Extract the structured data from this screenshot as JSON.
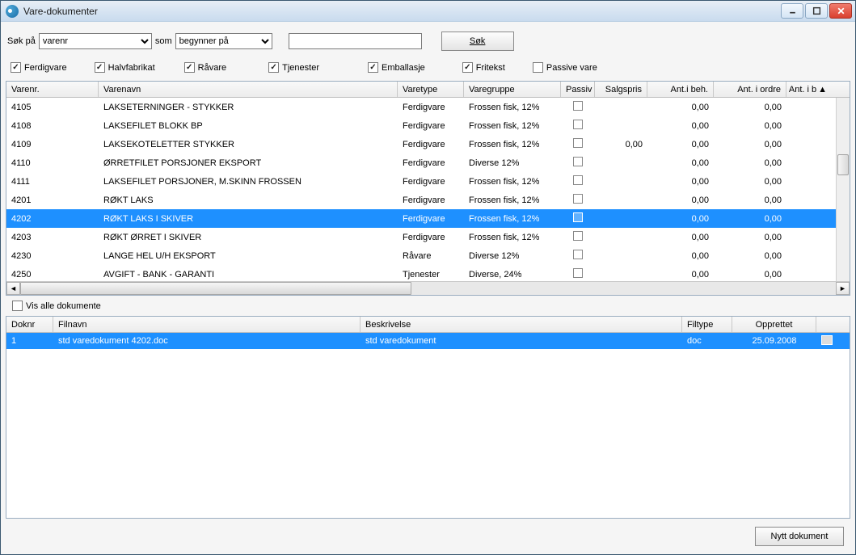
{
  "window": {
    "title": "Vare-dokumenter"
  },
  "search": {
    "label_sokpa": "Søk på",
    "field_options": [
      "varenr"
    ],
    "field_value": "varenr",
    "label_som": "som",
    "mode_options": [
      "begynner på"
    ],
    "mode_value": "begynner på",
    "input_value": "",
    "button": "Søk"
  },
  "filters": [
    {
      "label": "Ferdigvare",
      "checked": true
    },
    {
      "label": "Halvfabrikat",
      "checked": true
    },
    {
      "label": "Råvare",
      "checked": true
    },
    {
      "label": "Tjenester",
      "checked": true
    },
    {
      "label": "Emballasje",
      "checked": true
    },
    {
      "label": "Fritekst",
      "checked": true
    },
    {
      "label": "Passive vare",
      "checked": false
    }
  ],
  "products": {
    "columns": [
      "Varenr.",
      "Varenavn",
      "Varetype",
      "Varegruppe",
      "Passiv",
      "Salgspris",
      "Ant.i beh.",
      "Ant. i ordre",
      "Ant. i b"
    ],
    "rows": [
      {
        "nr": "4105",
        "navn": "LAKSETERNINGER - STYKKER",
        "type": "Ferdigvare",
        "gruppe": "Frossen fisk, 12%",
        "passiv": false,
        "salg": "",
        "beh": "0,00",
        "ordre": "0,00",
        "selected": false
      },
      {
        "nr": "4108",
        "navn": "LAKSEFILET BLOKK BP",
        "type": "Ferdigvare",
        "gruppe": "Frossen fisk, 12%",
        "passiv": false,
        "salg": "",
        "beh": "0,00",
        "ordre": "0,00",
        "selected": false
      },
      {
        "nr": "4109",
        "navn": "LAKSEKOTELETTER STYKKER",
        "type": "Ferdigvare",
        "gruppe": "Frossen fisk, 12%",
        "passiv": false,
        "salg": "0,00",
        "beh": "0,00",
        "ordre": "0,00",
        "selected": false
      },
      {
        "nr": "4110",
        "navn": "ØRRETFILET PORSJONER EKSPORT",
        "type": "Ferdigvare",
        "gruppe": "Diverse 12%",
        "passiv": false,
        "salg": "",
        "beh": "0,00",
        "ordre": "0,00",
        "selected": false
      },
      {
        "nr": "4111",
        "navn": "LAKSEFILET PORSJONER, M.SKINN FROSSEN",
        "type": "Ferdigvare",
        "gruppe": "Frossen fisk, 12%",
        "passiv": false,
        "salg": "",
        "beh": "0,00",
        "ordre": "0,00",
        "selected": false
      },
      {
        "nr": "4201",
        "navn": "RØKT LAKS",
        "type": "Ferdigvare",
        "gruppe": "Frossen fisk, 12%",
        "passiv": false,
        "salg": "",
        "beh": "0,00",
        "ordre": "0,00",
        "selected": false
      },
      {
        "nr": "4202",
        "navn": "RØKT LAKS I SKIVER",
        "type": "Ferdigvare",
        "gruppe": "Frossen fisk, 12%",
        "passiv": false,
        "salg": "",
        "beh": "0,00",
        "ordre": "0,00",
        "selected": true
      },
      {
        "nr": "4203",
        "navn": "RØKT ØRRET I SKIVER",
        "type": "Ferdigvare",
        "gruppe": "Frossen fisk, 12%",
        "passiv": false,
        "salg": "",
        "beh": "0,00",
        "ordre": "0,00",
        "selected": false
      },
      {
        "nr": "4230",
        "navn": "LANGE HEL U/H EKSPORT",
        "type": "Råvare",
        "gruppe": "Diverse 12%",
        "passiv": false,
        "salg": "",
        "beh": "0,00",
        "ordre": "0,00",
        "selected": false
      },
      {
        "nr": "4250",
        "navn": "AVGIFT - BANK - GARANTI",
        "type": "Tjenester",
        "gruppe": "Diverse, 24%",
        "passiv": false,
        "salg": "",
        "beh": "0,00",
        "ordre": "0,00",
        "selected": false
      }
    ]
  },
  "show_all_docs": {
    "label": "Vis alle dokumente",
    "checked": false
  },
  "documents": {
    "columns": [
      "Doknr",
      "Filnavn",
      "Beskrivelse",
      "Filtype",
      "Opprettet",
      ""
    ],
    "rows": [
      {
        "nr": "1",
        "filnavn": "std varedokument 4202.doc",
        "beskrivelse": "std varedokument",
        "filtype": "doc",
        "opprettet": "25.09.2008",
        "selected": true
      }
    ]
  },
  "footer": {
    "new_doc": "Nytt dokument"
  }
}
